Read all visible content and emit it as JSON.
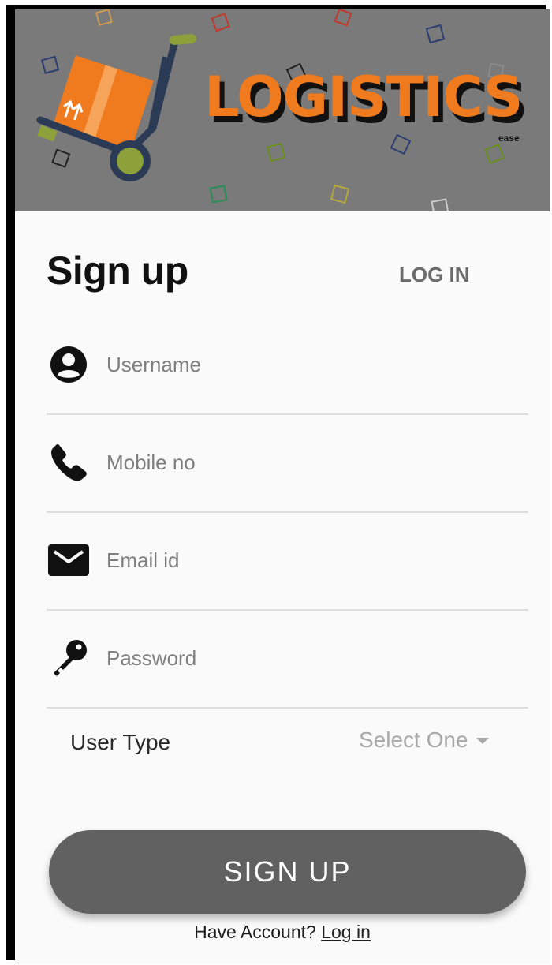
{
  "brand": {
    "logo_text": "LOGISTICS",
    "tagline": "ease"
  },
  "tabs": {
    "signup_title": "Sign up",
    "login_label": "LOG IN"
  },
  "form": {
    "username_placeholder": "Username",
    "mobile_placeholder": "Mobile no",
    "email_placeholder": "Email id",
    "password_placeholder": "Password",
    "user_type_label": "User Type",
    "user_type_selected": "Select One"
  },
  "icons": {
    "username": "account-circle-icon",
    "mobile": "phone-icon",
    "email": "envelope-icon",
    "password": "key-icon"
  },
  "actions": {
    "signup_button": "SIGN UP"
  },
  "footer": {
    "prompt": "Have Account?",
    "login_link": "Log in"
  },
  "colors": {
    "header_bg": "#7a7a7a",
    "brand_orange": "#f07a1e",
    "button_bg": "#616161",
    "page_bg": "#fafafa"
  }
}
